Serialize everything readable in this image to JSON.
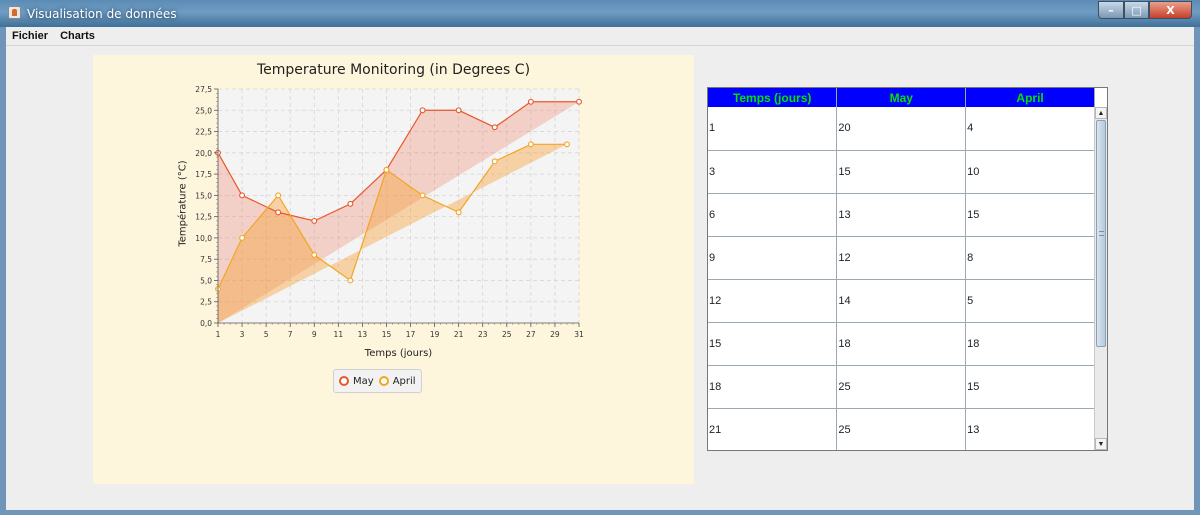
{
  "window": {
    "title": "Visualisation de données",
    "min_glyph": "–",
    "max_glyph": "□",
    "close_glyph": "X"
  },
  "menu": {
    "items": [
      "Fichier",
      "Charts"
    ]
  },
  "chart_data": {
    "type": "area",
    "title": "Temperature Monitoring (in Degrees C)",
    "xlabel": "Temps (jours)",
    "ylabel": "Température (°C)",
    "xlim": [
      1,
      31
    ],
    "ylim": [
      0,
      27.5
    ],
    "x_ticks": [
      "1",
      "3",
      "5",
      "7",
      "9",
      "11",
      "13",
      "15",
      "17",
      "19",
      "21",
      "23",
      "25",
      "27",
      "29",
      "31"
    ],
    "y_ticks": [
      "0,0",
      "2,5",
      "5,0",
      "7,5",
      "10,0",
      "12,5",
      "15,0",
      "17,5",
      "20,0",
      "22,5",
      "25,0",
      "27,5"
    ],
    "grid": true,
    "legend_position": "bottom",
    "series": [
      {
        "name": "May",
        "color": "#e8582a",
        "points": [
          [
            1,
            20
          ],
          [
            3,
            15
          ],
          [
            6,
            13
          ],
          [
            9,
            12
          ],
          [
            12,
            14
          ],
          [
            15,
            18
          ],
          [
            18,
            25
          ],
          [
            21,
            25
          ],
          [
            24,
            23
          ],
          [
            27,
            26
          ],
          [
            31,
            26
          ]
        ]
      },
      {
        "name": "April",
        "color": "#f4a523",
        "points": [
          [
            1,
            4
          ],
          [
            3,
            10
          ],
          [
            6,
            15
          ],
          [
            9,
            8
          ],
          [
            12,
            5
          ],
          [
            15,
            18
          ],
          [
            18,
            15
          ],
          [
            21,
            13
          ],
          [
            24,
            19
          ],
          [
            27,
            21
          ],
          [
            30,
            21
          ]
        ]
      }
    ]
  },
  "table": {
    "headers": [
      "Temps (jours)",
      "May",
      "April"
    ],
    "rows": [
      [
        "1",
        "20",
        "4"
      ],
      [
        "3",
        "15",
        "10"
      ],
      [
        "6",
        "13",
        "15"
      ],
      [
        "9",
        "12",
        "8"
      ],
      [
        "12",
        "14",
        "5"
      ],
      [
        "15",
        "18",
        "18"
      ],
      [
        "18",
        "25",
        "15"
      ],
      [
        "21",
        "25",
        "13"
      ]
    ],
    "scroll_up_glyph": "▲",
    "scroll_down_glyph": "▼"
  }
}
